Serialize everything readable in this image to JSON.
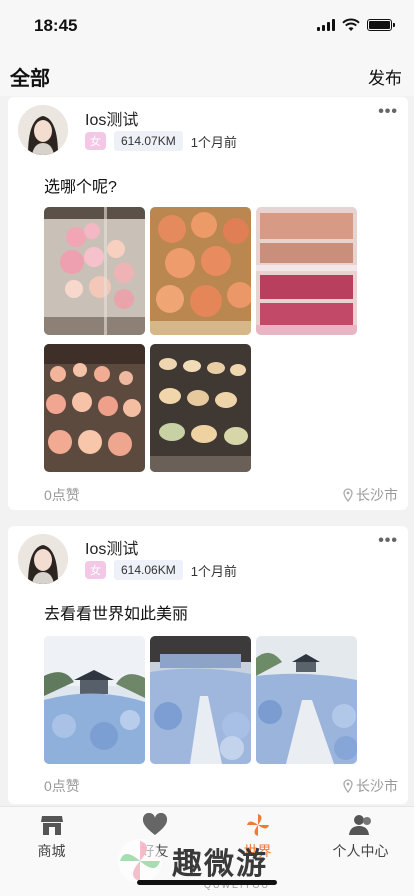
{
  "status_bar": {
    "time": "18:45"
  },
  "header": {
    "title": "全部",
    "publish_label": "发布"
  },
  "posts": [
    {
      "username": "Ios测试",
      "gender": "女",
      "distance": "614.07KM",
      "time_ago": "1个月前",
      "more": "•••",
      "text": "选哪个呢?",
      "likes": "0点赞",
      "location": "长沙市",
      "images": [
        "peach-buns-display",
        "peach-pastries",
        "pink-shelves",
        "peach-tray",
        "bun-rows"
      ]
    },
    {
      "username": "Ios测试",
      "gender": "女",
      "distance": "614.06KM",
      "time_ago": "1个月前",
      "more": "•••",
      "text": "去看看世界如此美丽",
      "likes": "0点赞",
      "location": "长沙市",
      "images": [
        "blue-flower-pavilion",
        "blue-flower-stage",
        "blue-flower-path"
      ]
    }
  ],
  "tabbar": {
    "items": [
      {
        "label": "商城",
        "icon": "shop-icon"
      },
      {
        "label": "好友",
        "icon": "heart-icon"
      },
      {
        "label": "世界",
        "icon": "pinwheel-icon",
        "active": true
      },
      {
        "label": "个人中心",
        "icon": "person-icon"
      }
    ]
  },
  "watermark": {
    "text": "趣微游",
    "sub": "QUWEIYOU"
  },
  "colors": {
    "accent": "#f07a36",
    "gender_badge": "#f2c8e6",
    "distance_bg": "#eef1f7"
  }
}
